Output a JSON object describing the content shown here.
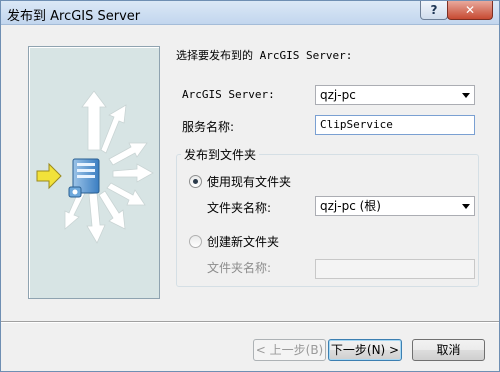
{
  "window": {
    "title": "发布到 ArcGIS Server",
    "help_label": "?",
    "close_label": "✕"
  },
  "main": {
    "heading": "选择要发布到的 ArcGIS Server:",
    "server_label": "ArcGIS Server:",
    "server_value": "qzj-pc",
    "service_name_label": "服务名称:",
    "service_name_value": "ClipService"
  },
  "folder_group": {
    "title": "发布到文件夹",
    "use_existing_label": "使用现有文件夹",
    "use_existing_selected": true,
    "folder_name_label": "文件夹名称:",
    "folder_value": "qzj-pc (根)",
    "create_new_label": "创建新文件夹",
    "create_new_selected": false,
    "new_folder_name_label": "文件夹名称:",
    "new_folder_value": ""
  },
  "buttons": {
    "back_label": "< 上一步(B)",
    "next_label": "下一步(N) >",
    "cancel_label": "取消"
  },
  "colors": {
    "arrow_yellow": "#f2e23a",
    "server_blue": "#4a8cc8",
    "panel_bg": "#d7e4e4"
  }
}
